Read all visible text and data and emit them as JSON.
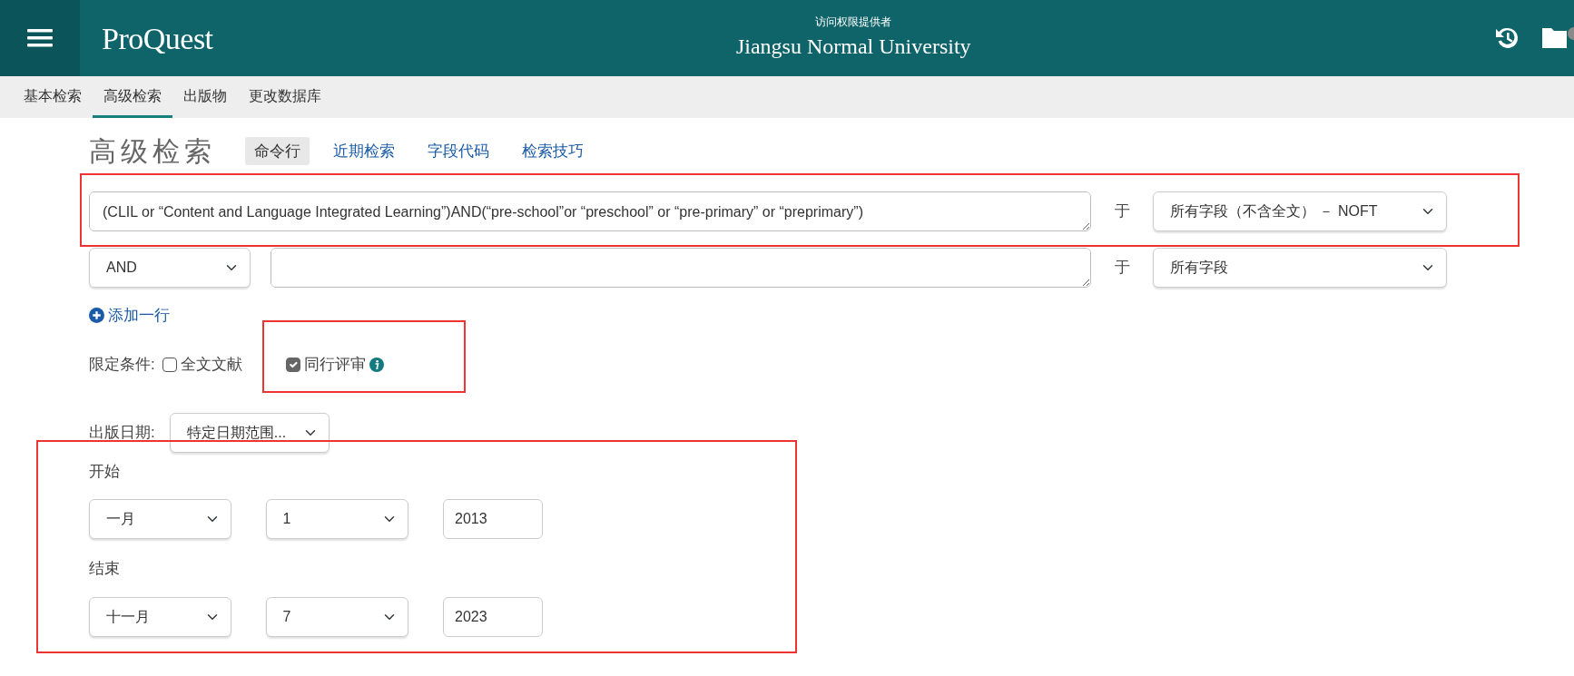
{
  "header": {
    "brand": "ProQuest",
    "access_label": "访问权限提供者",
    "institution": "Jiangsu Normal University"
  },
  "nav_tabs": [
    {
      "label": "基本检索",
      "selected": false
    },
    {
      "label": "高级检索",
      "selected": true
    },
    {
      "label": "出版物",
      "selected": false
    },
    {
      "label": "更改数据库",
      "selected": false
    }
  ],
  "page_title": "高级检索",
  "page_links": [
    {
      "label": "命令行",
      "selected": true
    },
    {
      "label": "近期检索",
      "selected": false
    },
    {
      "label": "字段代码",
      "selected": false
    },
    {
      "label": "检索技巧",
      "selected": false
    }
  ],
  "query_rows": [
    {
      "query": "(CLIL or “Content and Language Integrated Learning”)AND(“pre-school”or “preschool” or “pre-primary” or “preprimary”)",
      "in_label": "于",
      "field": "所有字段（不含全文） － NOFT",
      "highlighted": true
    },
    {
      "operator": "AND",
      "in_label": "于",
      "field": "所有字段",
      "highlighted": false
    }
  ],
  "add_row": "添加一行",
  "limits": {
    "label": "限定条件:",
    "options": [
      {
        "label": "全文文献",
        "checked": false,
        "info": false,
        "highlighted": false
      },
      {
        "label": "同行评审",
        "checked": true,
        "info": true,
        "highlighted": true
      }
    ]
  },
  "date": {
    "label": "出版日期:",
    "range_type": "特定日期范围...",
    "highlighted": true,
    "start": {
      "label": "开始",
      "month": "一月",
      "day": "1",
      "year": "2013"
    },
    "end": {
      "label": "结束",
      "month": "十一月",
      "day": "7",
      "year": "2023"
    }
  }
}
